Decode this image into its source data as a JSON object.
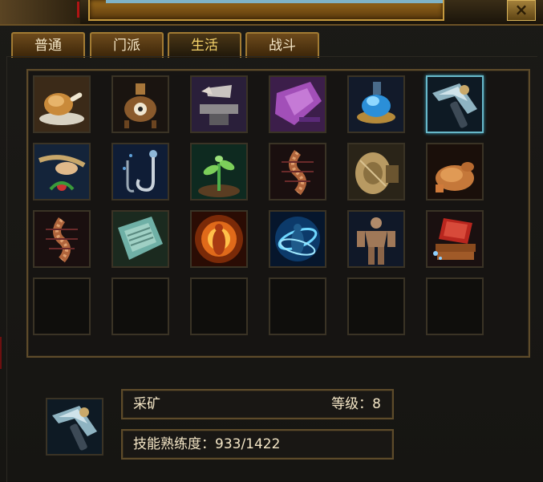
{
  "tabs": [
    {
      "label": "普通",
      "active": false
    },
    {
      "label": "门派",
      "active": false
    },
    {
      "label": "生活",
      "active": true
    },
    {
      "label": "战斗",
      "active": false
    }
  ],
  "window": {
    "close_label": "×"
  },
  "skill_grid": {
    "rows": [
      [
        "roast-chicken-leg-icon",
        "alchemy-furnace-icon",
        "anvil-forging-icon",
        "tailoring-cloth-icon",
        "blue-liquid-herb-icon",
        "mining-pickaxe-icon"
      ],
      [
        "herb-gathering-icon",
        "fishing-hook-icon",
        "sprout-planting-icon",
        "centipede-icon",
        "millstone-icon",
        "roast-chicken-icon"
      ],
      [
        "centipede-icon",
        "scroll-icon",
        "fire-aura-icon",
        "water-aura-icon",
        "muscle-body-icon",
        "stacked-books-icon"
      ],
      [
        "empty-slot",
        "empty-slot",
        "empty-slot",
        "empty-slot",
        "empty-slot",
        "empty-slot"
      ]
    ],
    "selected": {
      "row": 0,
      "col": 5
    }
  },
  "selected_skill": {
    "icon": "mining-pickaxe-icon",
    "name": "采矿",
    "level": "等级：8",
    "proficiency": "技能熟练度：933/1422"
  },
  "colors": {
    "accent_gold": "#a27b33",
    "selection_cyan": "#67b8c9",
    "text_light": "#f4e6c6"
  }
}
